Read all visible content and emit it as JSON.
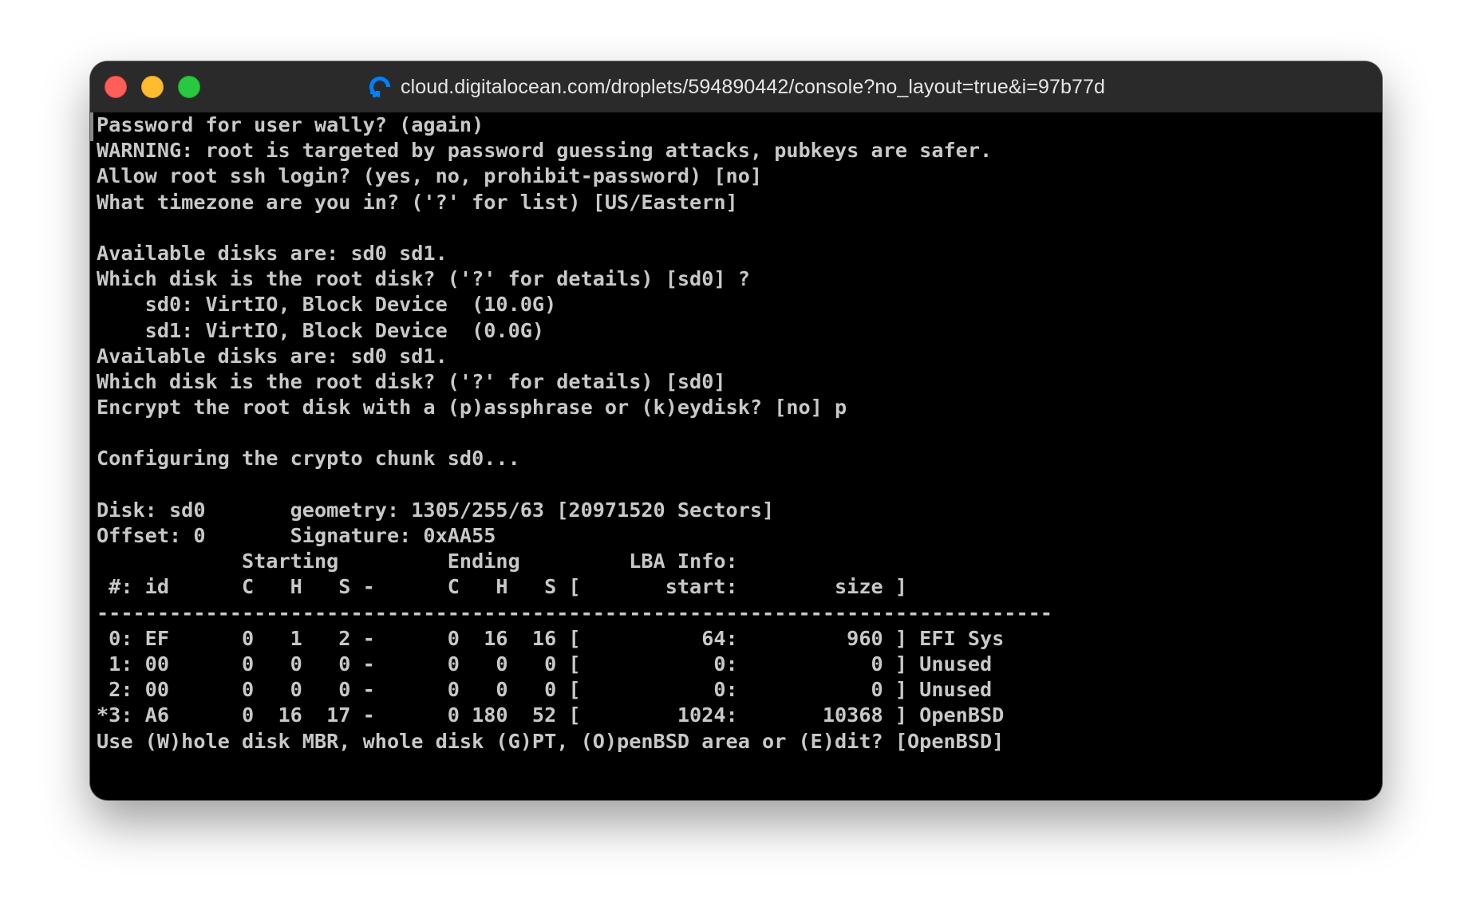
{
  "window": {
    "url": "cloud.digitalocean.com/droplets/594890442/console?no_layout=true&i=97b77d",
    "icon": "digitalocean-logo-icon",
    "traffic_lights": [
      "close",
      "minimize",
      "zoom"
    ]
  },
  "colors": {
    "terminal_bg": "#000000",
    "terminal_fg": "#c8c8c8",
    "titlebar_bg": "#2a2a2a",
    "digitalocean_blue": "#0080ff"
  },
  "terminal": {
    "lines": [
      "Password for user wally? (again)",
      "WARNING: root is targeted by password guessing attacks, pubkeys are safer.",
      "Allow root ssh login? (yes, no, prohibit-password) [no]",
      "What timezone are you in? ('?' for list) [US/Eastern]",
      "",
      "Available disks are: sd0 sd1.",
      "Which disk is the root disk? ('?' for details) [sd0] ?",
      "    sd0: VirtIO, Block Device  (10.0G)",
      "    sd1: VirtIO, Block Device  (0.0G)",
      "Available disks are: sd0 sd1.",
      "Which disk is the root disk? ('?' for details) [sd0]",
      "Encrypt the root disk with a (p)assphrase or (k)eydisk? [no] p",
      "",
      "Configuring the crypto chunk sd0...",
      "",
      "Disk: sd0       geometry: 1305/255/63 [20971520 Sectors]",
      "Offset: 0       Signature: 0xAA55",
      "            Starting         Ending         LBA Info:",
      " #: id      C   H   S -      C   H   S [       start:        size ]",
      "-------------------------------------------------------------------------------",
      " 0: EF      0   1   2 -      0  16  16 [          64:         960 ] EFI Sys",
      " 1: 00      0   0   0 -      0   0   0 [           0:           0 ] Unused",
      " 2: 00      0   0   0 -      0   0   0 [           0:           0 ] Unused",
      "*3: A6      0  16  17 -      0 180  52 [        1024:       10368 ] OpenBSD",
      "Use (W)hole disk MBR, whole disk (G)PT, (O)penBSD area or (E)dit? [OpenBSD]"
    ]
  }
}
